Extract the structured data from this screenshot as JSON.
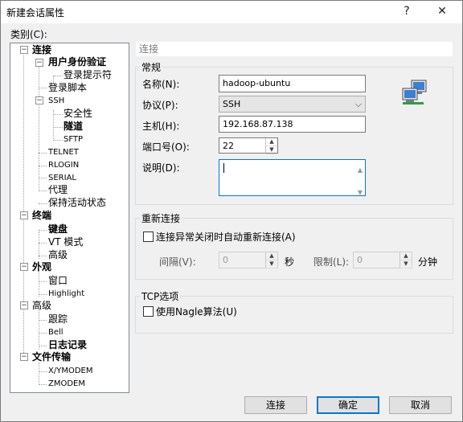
{
  "window": {
    "title": "新建会话属性",
    "help_glyph": "?",
    "close_glyph": "✕"
  },
  "category_label": "类别(C):",
  "tree": [
    {
      "label": "连接",
      "bold": true
    },
    {
      "label": "用户身份验证",
      "bold": true
    },
    {
      "label": "登录提示符"
    },
    {
      "label": "登录脚本"
    },
    {
      "label": "SSH",
      "small": true
    },
    {
      "label": "安全性"
    },
    {
      "label": "隧道",
      "bold": true
    },
    {
      "label": "SFTP",
      "small": true
    },
    {
      "label": "TELNET",
      "small": true
    },
    {
      "label": "RLOGIN",
      "small": true
    },
    {
      "label": "SERIAL",
      "small": true
    },
    {
      "label": "代理"
    },
    {
      "label": "保持活动状态"
    },
    {
      "label": "终端",
      "bold": true
    },
    {
      "label": "键盘",
      "bold": true
    },
    {
      "label": "VT 模式"
    },
    {
      "label": "高级"
    },
    {
      "label": "外观",
      "bold": true
    },
    {
      "label": "窗口"
    },
    {
      "label": "Highlight",
      "small": true
    },
    {
      "label": "高级"
    },
    {
      "label": "跟踪"
    },
    {
      "label": "Bell",
      "small": true
    },
    {
      "label": "日志记录",
      "bold": true
    },
    {
      "label": "文件传输",
      "bold": true
    },
    {
      "label": "X/YMODEM",
      "small": true
    },
    {
      "label": "ZMODEM",
      "small": true
    }
  ],
  "toggles": {
    "minus": "−",
    "plus": "+"
  },
  "section_title": "连接",
  "general": {
    "title": "常规",
    "name_label": "名称(N):",
    "name_value": "hadoop-ubuntu",
    "protocol_label": "协议(P):",
    "protocol_value": "SSH",
    "host_label": "主机(H):",
    "host_value": "192.168.87.138",
    "port_label": "端口号(O):",
    "port_value": "22",
    "desc_label": "说明(D):",
    "desc_value": ""
  },
  "reconnect": {
    "title": "重新连接",
    "auto_label": "连接异常关闭时自动重新连接(A)",
    "auto_checked": false,
    "interval_label": "间隔(V):",
    "interval_value": "0",
    "interval_unit": "秒",
    "limit_label": "限制(L):",
    "limit_value": "0",
    "limit_unit": "分钟"
  },
  "tcp": {
    "title": "TCP选项",
    "nagle_label": "使用Nagle算法(U)",
    "nagle_checked": false
  },
  "buttons": {
    "connect": "连接",
    "ok": "确定",
    "cancel": "取消"
  },
  "glyphs": {
    "chevron_down": "⌵",
    "spin_up": "▲",
    "spin_down": "▼"
  },
  "colors": {
    "accent": "#0078d7"
  }
}
